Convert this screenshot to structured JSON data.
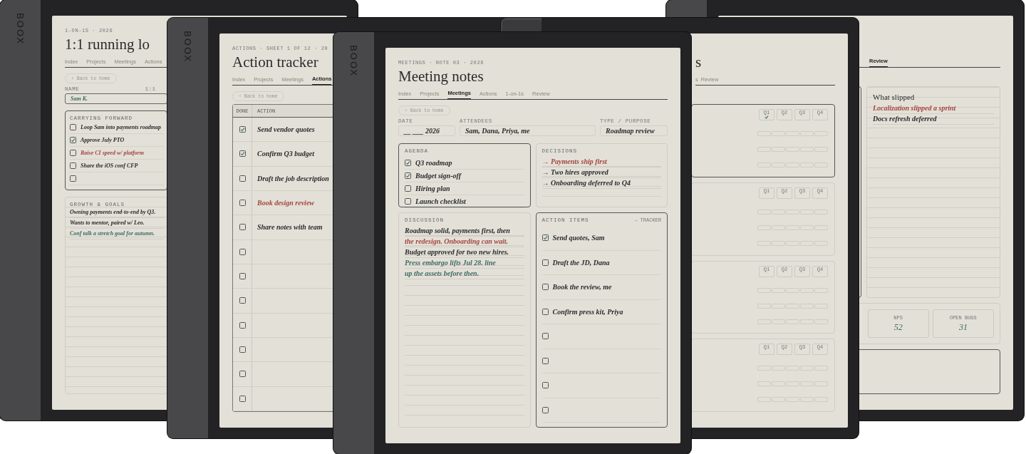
{
  "devices": [
    {
      "kind": "one_on_one",
      "brand": "BOOX",
      "eyebrow": "1-ON-1S · 2026",
      "title": "1:1 running lo",
      "tabs": [
        {
          "label": "Index",
          "selected": false
        },
        {
          "label": "Projects",
          "selected": false
        },
        {
          "label": "Meetings",
          "selected": false
        },
        {
          "label": "Actions",
          "selected": false
        }
      ],
      "back_button": "‹ Back to home",
      "name_label": "NAME",
      "aside_label": "1:1",
      "name_value": {
        "text": "Sam K.",
        "color": "#3e6b63"
      },
      "checklist": {
        "heading": "CARRYING FORWARD",
        "selected": true,
        "items": [
          {
            "text": "Loop Sam into payments roadmap",
            "checked": false,
            "color": "#2b2b2b"
          },
          {
            "text": "Approve July PTO",
            "checked": true,
            "color": "#2b2b2b"
          },
          {
            "text": "Raise CI speed w/ platform",
            "checked": false,
            "color": "#a3453d"
          },
          {
            "text": "Share the iOS conf CFP",
            "checked": false,
            "color": "#2b2b2b"
          },
          {
            "checked": false
          }
        ]
      },
      "notes": {
        "heading": "GROWTH & GOALS",
        "lines": [
          {
            "text": "Owning payments end-to-end by Q3.",
            "color": "#2b2b2b"
          },
          {
            "text": "Wants to mentor, paired w/ Leo.",
            "color": "#2b2b2b"
          },
          {
            "text": "Conf talk a stretch goal for autumn.",
            "color": "#3e6b63"
          }
        ]
      }
    },
    {
      "kind": "action_tracker",
      "brand": "BOOX",
      "eyebrow": "ACTIONS · SHEET 1 OF 12 · 20",
      "title": "Action tracker",
      "tabs": [
        {
          "label": "Index",
          "selected": false
        },
        {
          "label": "Projects",
          "selected": false
        },
        {
          "label": "Meetings",
          "selected": false
        },
        {
          "label": "Actions",
          "selected": true
        }
      ],
      "back_button": "‹ Back to home",
      "table": {
        "columns": [
          "DONE",
          "ACTION"
        ],
        "rows": [
          {
            "done": true,
            "action": "Send vendor quotes",
            "color": "#2b2b2b"
          },
          {
            "done": true,
            "action": "Confirm Q3 budget",
            "color": "#2b2b2b"
          },
          {
            "done": false,
            "action": "Draft the job description",
            "color": "#2b2b2b"
          },
          {
            "done": false,
            "action": "Book design review",
            "color": "#a3453d"
          },
          {
            "done": false,
            "action": "Share notes with team",
            "color": "#2b2b2b"
          },
          {
            "done": false
          },
          {
            "done": false
          },
          {
            "done": false
          },
          {
            "done": false
          },
          {
            "done": false
          },
          {
            "done": false
          },
          {
            "done": false
          }
        ]
      }
    },
    {
      "kind": "meeting_notes",
      "brand": "BOOX",
      "eyebrow": "MEETINGS · NOTE 03 · 2026",
      "title": "Meeting notes",
      "tabs": [
        {
          "label": "Index",
          "selected": false
        },
        {
          "label": "Projects",
          "selected": false
        },
        {
          "label": "Meetings",
          "selected": true
        },
        {
          "label": "Actions",
          "selected": false
        },
        {
          "label": "1-on-1s",
          "selected": false
        },
        {
          "label": "Review",
          "selected": false
        }
      ],
      "back_button": "‹ Back to home",
      "fields": [
        {
          "label": "DATE",
          "value": "__ ___ 2026"
        },
        {
          "label": "ATTENDEES",
          "value": "Sam, Dana, Priya, me"
        },
        {
          "label": "TYPE / PURPOSE",
          "value": "Roadmap review"
        }
      ],
      "cards": [
        {
          "kind": "checklist",
          "heading": "AGENDA",
          "selected": true,
          "items": [
            {
              "text": "Q3 roadmap",
              "checked": true,
              "color": "#2b2b2b"
            },
            {
              "text": "Budget sign-off",
              "checked": true,
              "color": "#2b2b2b"
            },
            {
              "text": "Hiring plan",
              "checked": false,
              "color": "#2b2b2b"
            },
            {
              "text": "Launch checklist",
              "checked": false,
              "color": "#2b2b2b"
            }
          ]
        },
        {
          "kind": "lines",
          "heading": "DECISIONS",
          "selected": false,
          "lines": [
            {
              "text": "→ Payments ship first",
              "color": "#a3453d"
            },
            {
              "text": "→ Two hires approved",
              "color": "#2b2b2b"
            },
            {
              "text": "→ Onboarding deferred to Q4",
              "color": "#2b2b2b"
            }
          ]
        },
        {
          "kind": "lines",
          "heading": "DISCUSSION",
          "selected": false,
          "lines": [
            {
              "text": "Roadmap solid, payments first, then",
              "color": "#2b2b2b"
            },
            {
              "text": "the redesign. Onboarding can wait.",
              "color": "#a3453d"
            },
            {
              "text": "Budget approved for two new hires.",
              "color": "#2b2b2b"
            },
            {
              "text": "Press embargo lifts Jul 28. line",
              "color": "#3e6b63"
            },
            {
              "text": "up the assets before then.",
              "color": "#3e6b63"
            }
          ]
        },
        {
          "kind": "checklist",
          "heading": "ACTION ITEMS",
          "link": "→ TRACKER",
          "selected": true,
          "items": [
            {
              "text": "Send quotes, Sam",
              "checked": true,
              "color": "#2b2b2b"
            },
            {
              "text": "Draft the JD, Dana",
              "checked": false,
              "color": "#2b2b2b"
            },
            {
              "text": "Book the review, me",
              "checked": false,
              "color": "#2b2b2b"
            },
            {
              "text": "Confirm press kit, Priya",
              "checked": false,
              "color": "#2b2b2b"
            },
            {
              "checked": false
            },
            {
              "checked": false
            },
            {
              "checked": false
            },
            {
              "checked": false
            }
          ]
        }
      ]
    },
    {
      "kind": "quarterly",
      "title": "s",
      "tabs": [
        {
          "label": "s",
          "selected": false
        },
        {
          "label": "Review",
          "selected": false
        }
      ],
      "cards": [
        {
          "selected": true,
          "quarters": [
            {
              "label": "Q1",
              "checked": true
            },
            {
              "label": "Q2",
              "checked": false
            },
            {
              "label": "Q3",
              "checked": false
            },
            {
              "label": "Q4",
              "checked": false
            }
          ]
        },
        {
          "selected": false,
          "quarters": [
            {
              "label": "Q1",
              "checked": false
            },
            {
              "label": "Q2",
              "checked": false
            },
            {
              "label": "Q3",
              "checked": false
            },
            {
              "label": "Q4",
              "checked": false
            }
          ]
        },
        {
          "selected": false,
          "quarters": [
            {
              "label": "Q1",
              "checked": false
            },
            {
              "label": "Q2",
              "checked": false
            },
            {
              "label": "Q3",
              "checked": false
            },
            {
              "label": "Q4",
              "checked": false
            }
          ]
        },
        {
          "selected": false,
          "quarters": [
            {
              "label": "Q1",
              "checked": false
            },
            {
              "label": "Q2",
              "checked": false
            },
            {
              "label": "Q3",
              "checked": false
            },
            {
              "label": "Q4",
              "checked": false
            }
          ]
        }
      ]
    },
    {
      "kind": "review",
      "tabs": [
        {
          "label": "Review",
          "selected": true
        }
      ],
      "notes": {
        "title": "What slipped",
        "lines": [
          {
            "text": "Localization slipped a sprint",
            "color": "#a3453d"
          },
          {
            "text": "Docs refresh deferred",
            "color": "#2b2b2b"
          }
        ]
      },
      "stats": [
        {
          "label": "NPS",
          "value": "52"
        },
        {
          "label": "OPEN BUGS",
          "value": "31"
        }
      ]
    }
  ]
}
